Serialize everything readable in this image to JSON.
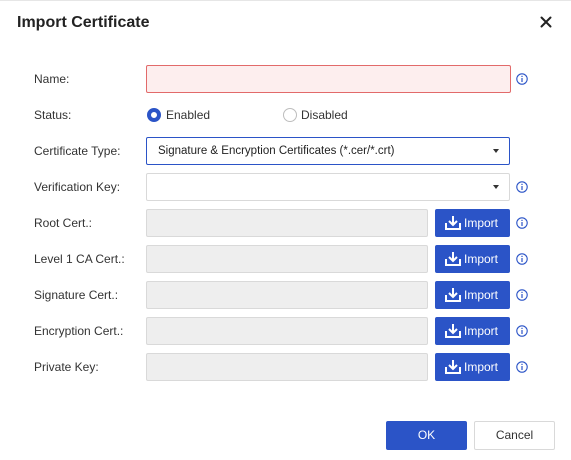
{
  "dialog": {
    "title": "Import Certificate",
    "ok_label": "OK",
    "cancel_label": "Cancel"
  },
  "form": {
    "name": {
      "label": "Name:",
      "value": "",
      "state": "error"
    },
    "status": {
      "label": "Status:",
      "options": [
        {
          "label": "Enabled",
          "checked": true
        },
        {
          "label": "Disabled",
          "checked": false
        }
      ]
    },
    "certificate_type": {
      "label": "Certificate Type:",
      "selected": "Signature & Encryption Certificates (*.cer/*.crt)"
    },
    "verification_key": {
      "label": "Verification Key:",
      "selected": ""
    },
    "import_rows": [
      {
        "label": "Root Cert.:",
        "value": "",
        "button": "Import"
      },
      {
        "label": "Level 1 CA Cert.:",
        "value": "",
        "button": "Import"
      },
      {
        "label": "Signature Cert.:",
        "value": "",
        "button": "Import"
      },
      {
        "label": "Encryption Cert.:",
        "value": "",
        "button": "Import"
      },
      {
        "label": "Private Key:",
        "value": "",
        "button": "Import"
      }
    ]
  },
  "icons": {
    "close": "close-icon",
    "info": "info-icon",
    "import": "import-icon",
    "dropdown": "chevron-down-icon"
  },
  "colors": {
    "primary": "#2b54c7",
    "error_border": "#e26a6a",
    "error_background": "#fdeeee",
    "disabled_background": "#eeeeee"
  }
}
